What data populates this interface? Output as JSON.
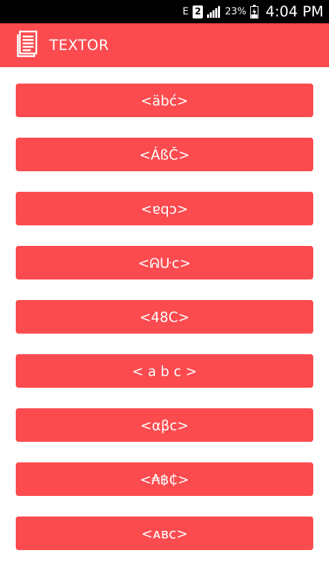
{
  "status_bar": {
    "network_label": "E",
    "sim_label": "2",
    "battery": "23%",
    "time": "4:04 PM"
  },
  "app_bar": {
    "title": "TEXTOR",
    "icon": "document-icon"
  },
  "colors": {
    "accent": "#fc4b4f",
    "status_bar": "#000000",
    "text_on_accent": "#ffffff"
  },
  "styles": [
    {
      "label": "<äbć>"
    },
    {
      "label": "<ÁßČ>"
    },
    {
      "label": "<ɐqɔ>"
    },
    {
      "label": "<ᕱᑘc>"
    },
    {
      "label": "<48C>"
    },
    {
      "label": "< a b c >"
    },
    {
      "label": "<αβc>"
    },
    {
      "label": "<₳฿₵>"
    },
    {
      "label": "<ᴀʙᴄ>"
    }
  ]
}
